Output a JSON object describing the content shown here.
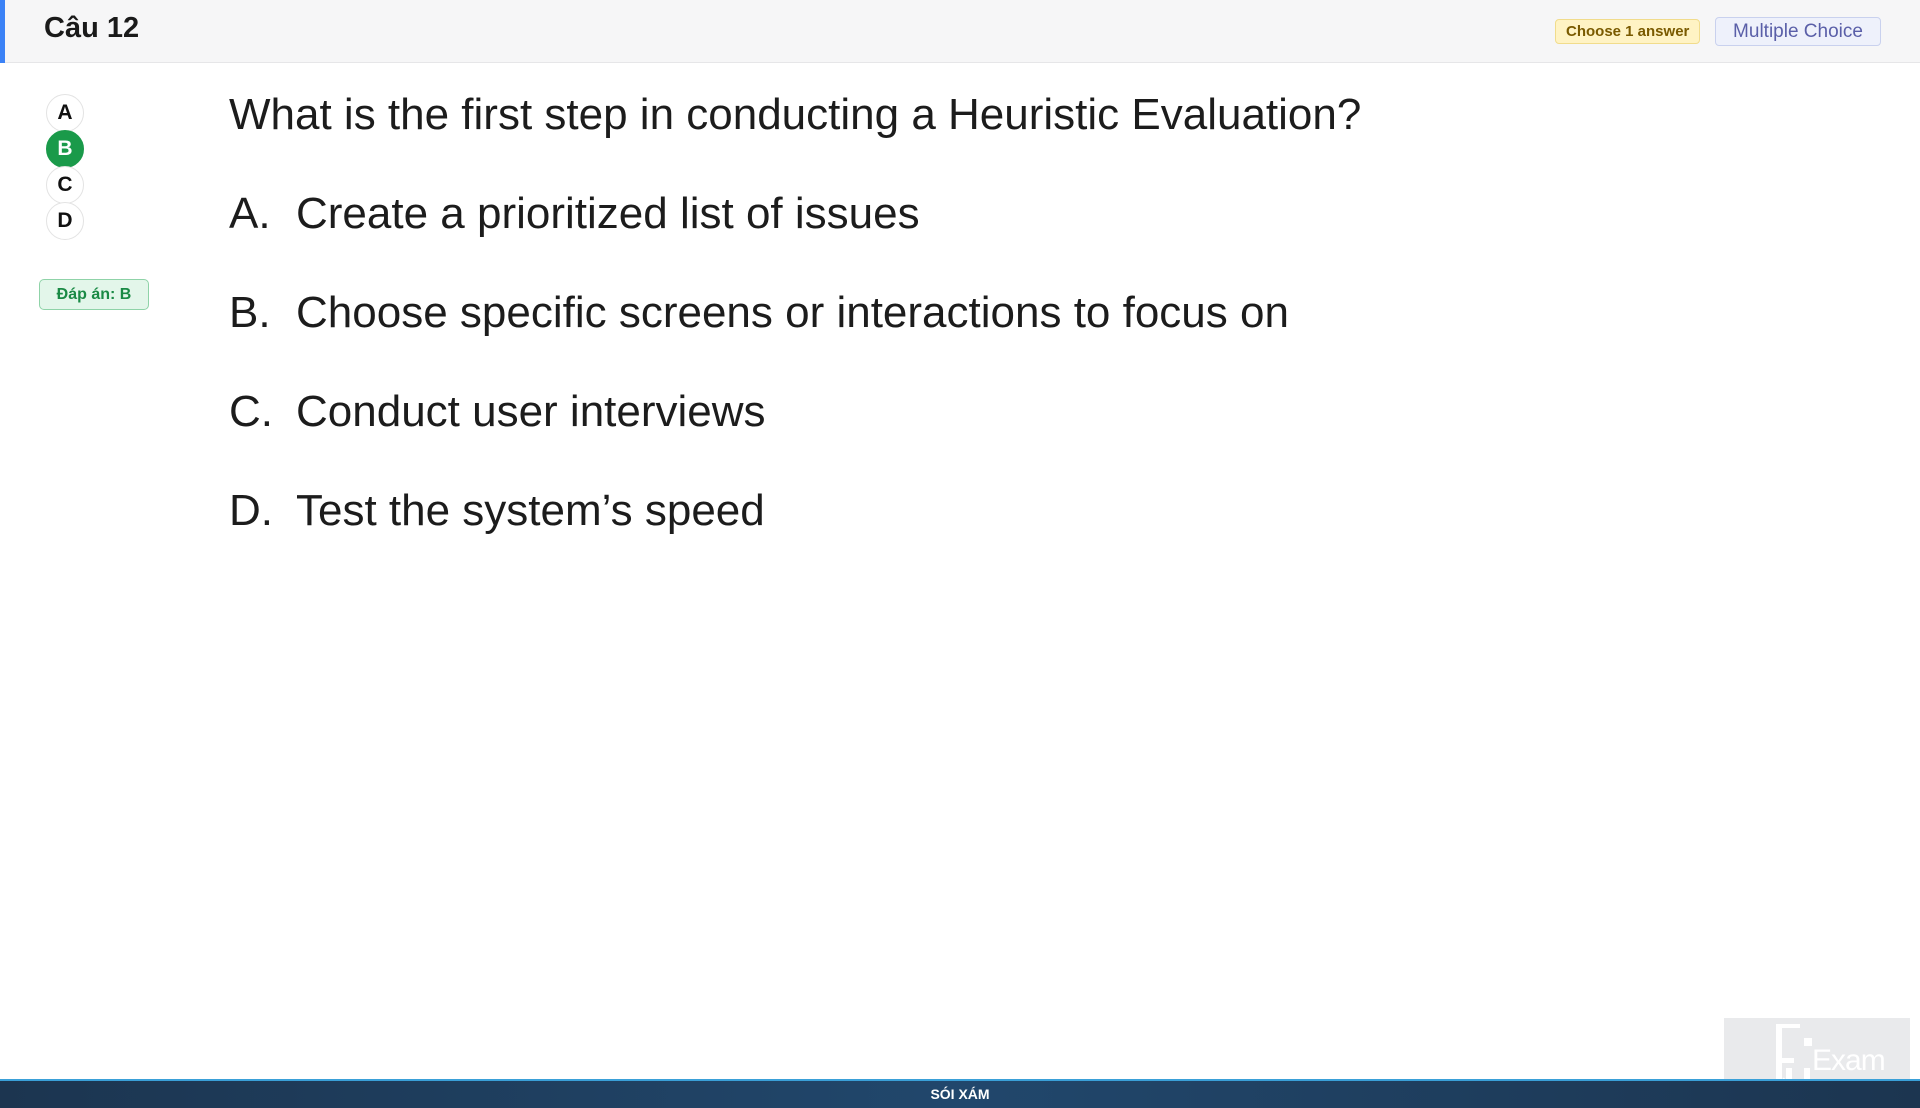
{
  "header": {
    "question_number": "Câu 12",
    "choose_badge": "Choose 1 answer",
    "type_badge": "Multiple Choice"
  },
  "answer_column": {
    "options": [
      "A",
      "B",
      "C",
      "D"
    ],
    "selected": "B",
    "answer_label": "Đáp án: B"
  },
  "question": {
    "text": "What is the first step in conducting a Heuristic Evaluation?",
    "options": [
      {
        "letter": "A.",
        "text": "Create a prioritized list of issues"
      },
      {
        "letter": "B.",
        "text": "Choose specific screens or interactions to focus on"
      },
      {
        "letter": "C.",
        "text": "Conduct user interviews"
      },
      {
        "letter": "D.",
        "text": "Test the system’s speed"
      }
    ]
  },
  "footer": {
    "text": "SÓI XÁM"
  },
  "logo": {
    "text": "Exam",
    "icon": "fu-exam-logo-icon"
  },
  "colors": {
    "accent": "#3b82f6",
    "selected_green": "#1a9a4a",
    "footer_bg": "#21476c"
  }
}
